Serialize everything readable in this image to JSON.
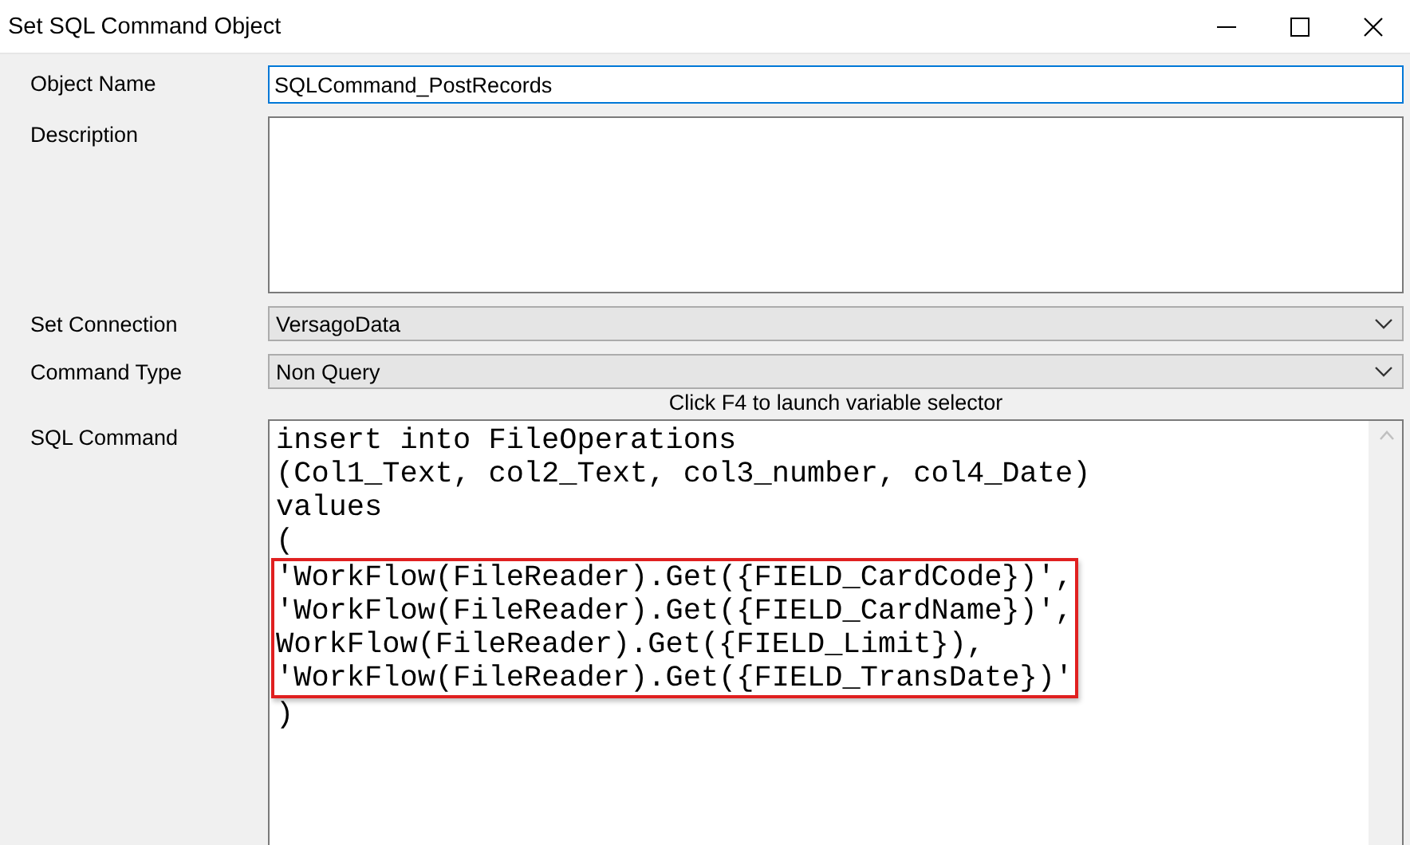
{
  "window": {
    "title": "Set SQL Command Object"
  },
  "fields": [
    {
      "kind": "text",
      "label": "Object Name",
      "value": "SQLCommand_PostRecords",
      "focused": true
    },
    {
      "kind": "textarea",
      "label": "Description",
      "focused": false
    },
    {
      "kind": "combo",
      "label": "Set Connection",
      "value": "VersagoData",
      "focused": false
    },
    {
      "kind": "combo",
      "label": "Command Type",
      "value": "Non Query",
      "focused": false
    }
  ],
  "hint": "Click F4 to launch variable selector",
  "sql_command": {
    "label": "SQL Command",
    "lines": [
      {
        "text": "insert into FileOperations",
        "highlighted": false
      },
      {
        "text": "(Col1_Text, col2_Text, col3_number, col4_Date)",
        "highlighted": false
      },
      {
        "text": "values",
        "highlighted": false
      },
      {
        "text": "(",
        "highlighted": false
      },
      {
        "text": "'WorkFlow(FileReader).Get({FIELD_CardCode})',",
        "highlighted": true
      },
      {
        "text": "'WorkFlow(FileReader).Get({FIELD_CardName})',",
        "highlighted": true
      },
      {
        "text": "WorkFlow(FileReader).Get({FIELD_Limit}),",
        "highlighted": true
      },
      {
        "text": "'WorkFlow(FileReader).Get({FIELD_TransDate})'",
        "highlighted": true
      },
      {
        "text": ")",
        "highlighted": false
      }
    ]
  }
}
